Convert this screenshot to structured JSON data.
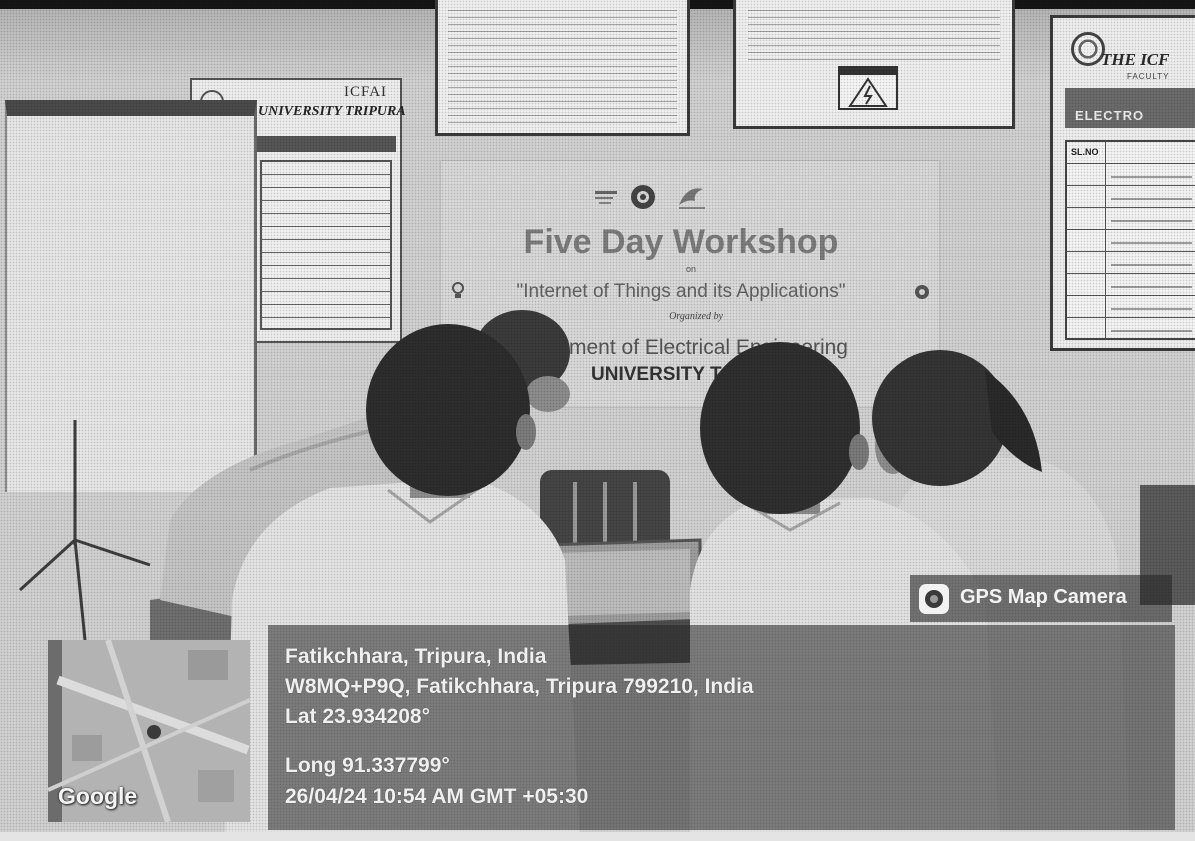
{
  "banner": {
    "title": "Five Day Workshop",
    "on": "on",
    "topic": "\"Internet of Things and its Applications\"",
    "organized_by": "Organized by",
    "department": "ment of Electrical Engineering",
    "university": "UNIVERSITY T",
    "icons": [
      "logo-icon",
      "gear-logo-icon",
      "bird-logo-icon",
      "bulb-icon",
      "gear-icon"
    ]
  },
  "left_poster": {
    "university": "UNIVERSITY TRIPURA",
    "logo_text": "ICFAI"
  },
  "right_poster": {
    "title": "THE ICF",
    "subtitle": "FACULTY",
    "band": "ELECTRO",
    "table_header": "SL.NO"
  },
  "top_poster": {
    "sign_icon": "warning-icon"
  },
  "gps": {
    "brand": "GPS Map Camera",
    "brand_icon": "camera-icon",
    "map_label": "Google",
    "location": "Fatikchhara, Tripura, India",
    "address": "W8MQ+P9Q, Fatikchhara, Tripura 799210, India",
    "lat": "Lat 23.934208°",
    "long": "Long 91.337799°",
    "datetime": "26/04/24 10:54 AM GMT +05:30"
  },
  "colors": {
    "overlay": "#262626",
    "overlay_text": "#f0f0f0",
    "wall": "#d0d0d0",
    "hair": "#2f2f2f",
    "shirt": "#e1e1e1"
  }
}
